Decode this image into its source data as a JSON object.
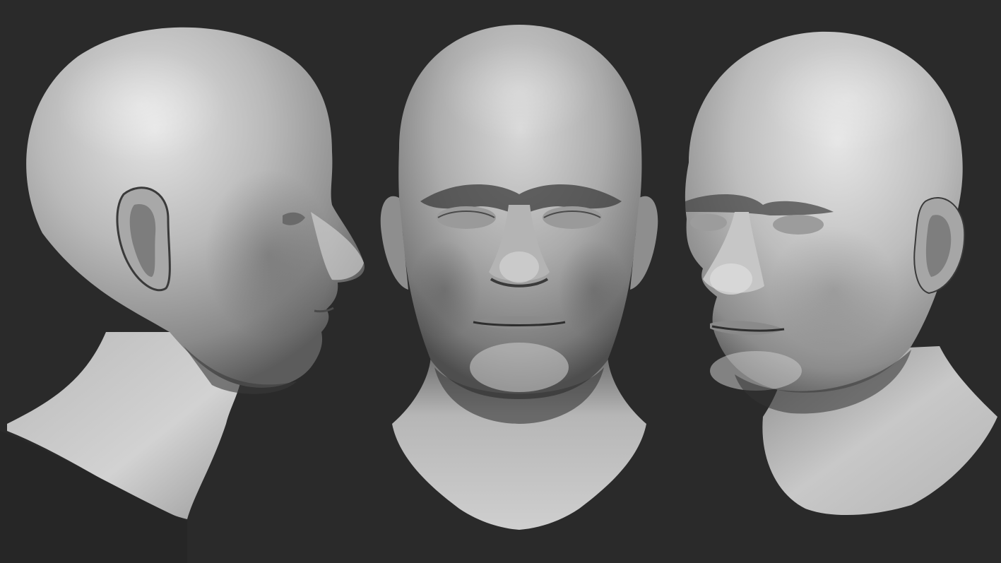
{
  "scene": {
    "background_color": "#2a2a2a",
    "subject": "bald-male-head-sculpt",
    "material": "matte-grey-clay",
    "views": [
      {
        "id": "profile-right",
        "facing": "right"
      },
      {
        "id": "front",
        "facing": "viewer"
      },
      {
        "id": "three-quarter-left",
        "facing": "left"
      }
    ]
  }
}
